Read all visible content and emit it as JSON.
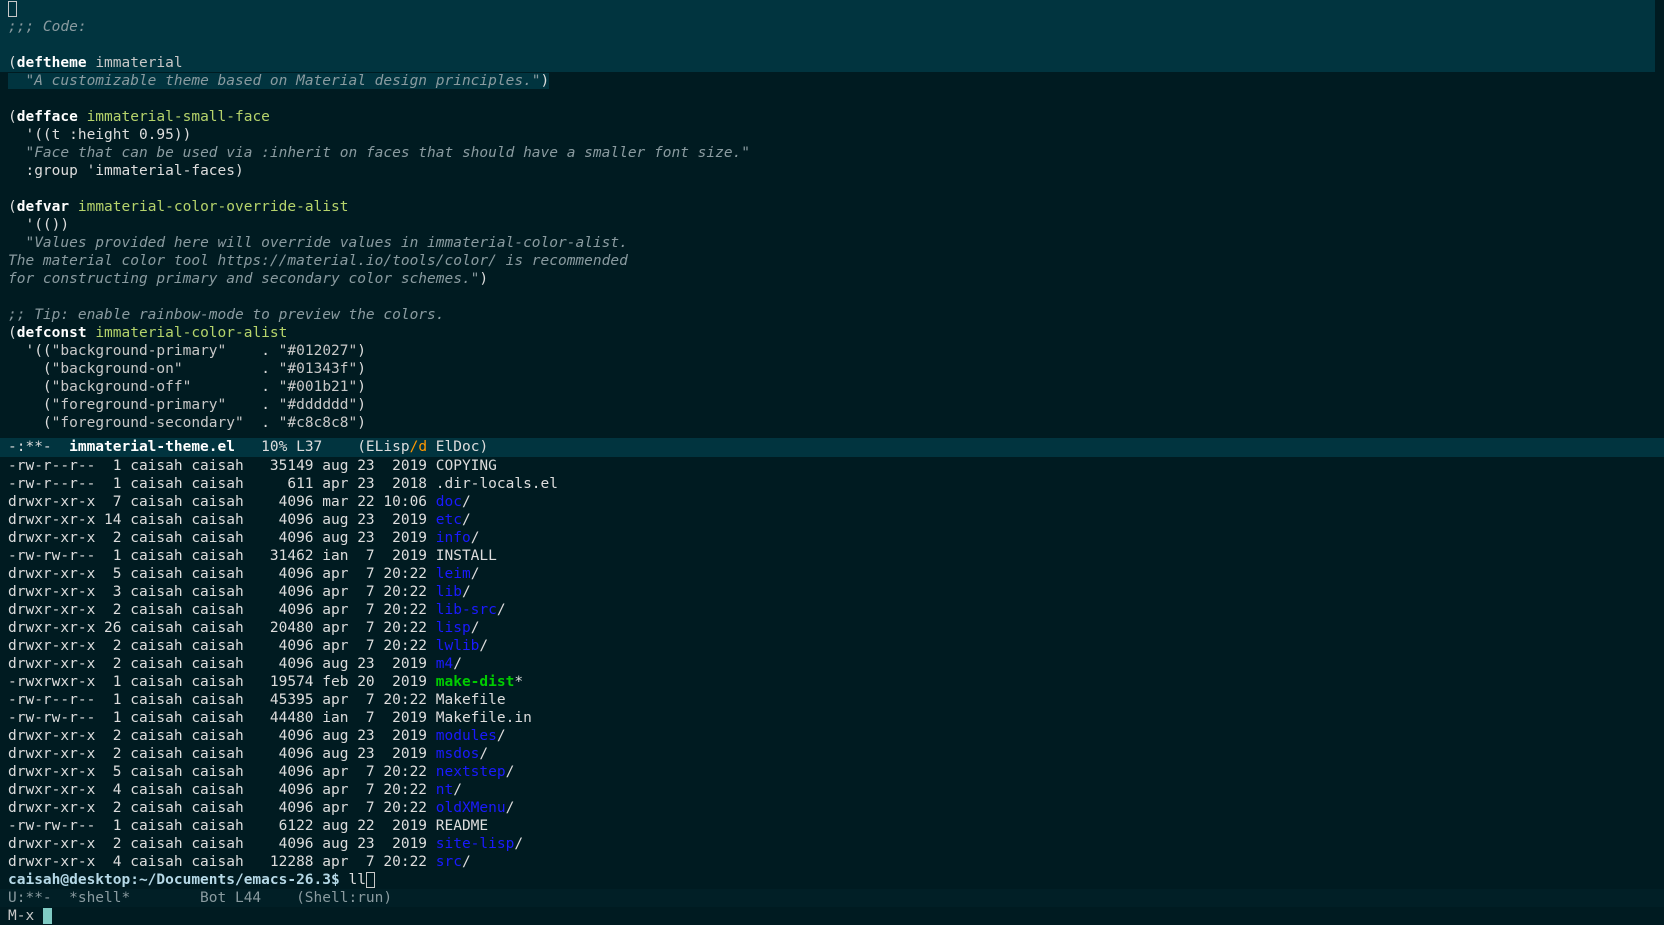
{
  "editor": {
    "code_header": ";;; Code:",
    "deftheme_kw": "deftheme",
    "deftheme_name": "immaterial",
    "deftheme_doc": "\"A customizable theme based on Material design principles.\"",
    "defface_kw": "defface",
    "defface_name": "immaterial-small-face",
    "defface_val": "'((t :height 0.95))",
    "defface_doc": "\"Face that can be used via :inherit on faces that should have a smaller font size.\"",
    "defface_group": ":group 'immaterial-faces)",
    "defvar_kw": "defvar",
    "defvar_name": "immaterial-color-override-alist",
    "defvar_val": "'(())",
    "defvar_doc1": "\"Values provided here will override values in immaterial-color-alist.",
    "defvar_doc2": "The material color tool https://material.io/tools/color/ is recommended",
    "defvar_doc3": "for constructing primary and secondary color schemes.\"",
    "tip_comment": ";; Tip: enable rainbow-mode to preview the colors.",
    "defconst_kw": "defconst",
    "defconst_name": "immaterial-color-alist",
    "colors": [
      {
        "prefix": "'((",
        "key": "\"background-primary\"",
        "pad": "    . ",
        "val": "\"#012027\"",
        "suffix": ")"
      },
      {
        "prefix": "  (",
        "key": "\"background-on\"",
        "pad": "         . ",
        "val": "\"#01343f\"",
        "suffix": ")"
      },
      {
        "prefix": "  (",
        "key": "\"background-off\"",
        "pad": "        . ",
        "val": "\"#001b21\"",
        "suffix": ")"
      },
      {
        "prefix": "  (",
        "key": "\"foreground-primary\"",
        "pad": "    . ",
        "val": "\"#dddddd\"",
        "suffix": ")"
      },
      {
        "prefix": "  (",
        "key": "\"foreground-secondary\"",
        "pad": "  . ",
        "val": "\"#c8c8c8\"",
        "suffix": ")"
      }
    ]
  },
  "mode_line_top": {
    "status": "-:**-  ",
    "buffer": "immaterial-theme.el",
    "position": "   10% L37    ",
    "mode_open": "(ELisp",
    "mode_slash": "/d",
    "mode_close": " ElDoc)"
  },
  "listing": [
    {
      "meta": "-rw-r--r--  1 caisah caisah   35149 aug 23  2019 ",
      "name": "COPYING",
      "kind": "file",
      "suffix": ""
    },
    {
      "meta": "-rw-r--r--  1 caisah caisah     611 apr 23  2018 ",
      "name": ".dir-locals.el",
      "kind": "file",
      "suffix": ""
    },
    {
      "meta": "drwxr-xr-x  7 caisah caisah    4096 mar 22 10:06 ",
      "name": "doc",
      "kind": "dir",
      "suffix": "/"
    },
    {
      "meta": "drwxr-xr-x 14 caisah caisah    4096 aug 23  2019 ",
      "name": "etc",
      "kind": "dir",
      "suffix": "/"
    },
    {
      "meta": "drwxr-xr-x  2 caisah caisah    4096 aug 23  2019 ",
      "name": "info",
      "kind": "dir",
      "suffix": "/"
    },
    {
      "meta": "-rw-rw-r--  1 caisah caisah   31462 ian  7  2019 ",
      "name": "INSTALL",
      "kind": "file",
      "suffix": ""
    },
    {
      "meta": "drwxr-xr-x  5 caisah caisah    4096 apr  7 20:22 ",
      "name": "leim",
      "kind": "dir",
      "suffix": "/"
    },
    {
      "meta": "drwxr-xr-x  3 caisah caisah    4096 apr  7 20:22 ",
      "name": "lib",
      "kind": "dir",
      "suffix": "/"
    },
    {
      "meta": "drwxr-xr-x  2 caisah caisah    4096 apr  7 20:22 ",
      "name": "lib-src",
      "kind": "dir",
      "suffix": "/"
    },
    {
      "meta": "drwxr-xr-x 26 caisah caisah   20480 apr  7 20:22 ",
      "name": "lisp",
      "kind": "dir",
      "suffix": "/"
    },
    {
      "meta": "drwxr-xr-x  2 caisah caisah    4096 apr  7 20:22 ",
      "name": "lwlib",
      "kind": "dir",
      "suffix": "/"
    },
    {
      "meta": "drwxr-xr-x  2 caisah caisah    4096 aug 23  2019 ",
      "name": "m4",
      "kind": "dir",
      "suffix": "/"
    },
    {
      "meta": "-rwxrwxr-x  1 caisah caisah   19574 feb 20  2019 ",
      "name": "make-dist",
      "kind": "exe",
      "suffix": "*"
    },
    {
      "meta": "-rw-r--r--  1 caisah caisah   45395 apr  7 20:22 ",
      "name": "Makefile",
      "kind": "file",
      "suffix": ""
    },
    {
      "meta": "-rw-rw-r--  1 caisah caisah   44480 ian  7  2019 ",
      "name": "Makefile.in",
      "kind": "file",
      "suffix": ""
    },
    {
      "meta": "drwxr-xr-x  2 caisah caisah    4096 aug 23  2019 ",
      "name": "modules",
      "kind": "dir",
      "suffix": "/"
    },
    {
      "meta": "drwxr-xr-x  2 caisah caisah    4096 aug 23  2019 ",
      "name": "msdos",
      "kind": "dir",
      "suffix": "/"
    },
    {
      "meta": "drwxr-xr-x  5 caisah caisah    4096 apr  7 20:22 ",
      "name": "nextstep",
      "kind": "dir",
      "suffix": "/"
    },
    {
      "meta": "drwxr-xr-x  4 caisah caisah    4096 apr  7 20:22 ",
      "name": "nt",
      "kind": "dir",
      "suffix": "/"
    },
    {
      "meta": "drwxr-xr-x  2 caisah caisah    4096 apr  7 20:22 ",
      "name": "oldXMenu",
      "kind": "dir",
      "suffix": "/"
    },
    {
      "meta": "-rw-rw-r--  1 caisah caisah    6122 aug 22  2019 ",
      "name": "README",
      "kind": "file",
      "suffix": ""
    },
    {
      "meta": "drwxr-xr-x  2 caisah caisah    4096 aug 23  2019 ",
      "name": "site-lisp",
      "kind": "dir",
      "suffix": "/"
    },
    {
      "meta": "drwxr-xr-x  4 caisah caisah   12288 apr  7 20:22 ",
      "name": "src",
      "kind": "dir",
      "suffix": "/"
    }
  ],
  "shell": {
    "prompt": "caisah@desktop:~/Documents/emacs-26.3$",
    "command": " ll"
  },
  "mode_line_bottom": {
    "text": "U:**-  *shell*        Bot L44    (Shell:run)"
  },
  "minibuffer": {
    "text": "M-x "
  }
}
